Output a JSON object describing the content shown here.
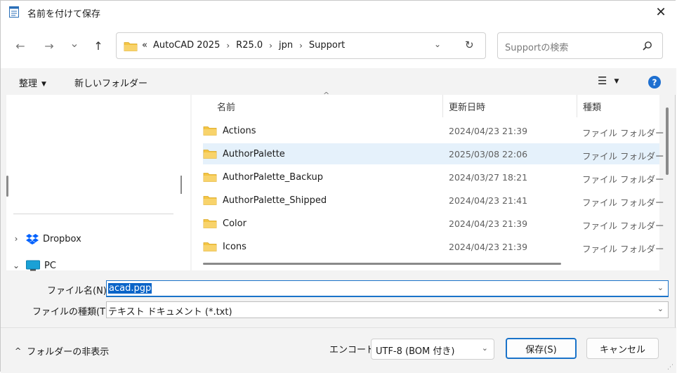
{
  "window": {
    "title": "名前を付けて保存",
    "close_glyph": "✕"
  },
  "nav": {
    "back_glyph": "←",
    "forward_glyph": "→",
    "recent_glyph": "⌄",
    "up_glyph": "↑",
    "address": {
      "prefix": "«",
      "crumbs": [
        "AutoCAD 2025",
        "R25.0",
        "jpn",
        "Support"
      ],
      "separator": "›",
      "dropdown_glyph": "⌄",
      "refresh_glyph": "↻"
    },
    "search_placeholder": "Supportの検索"
  },
  "toolbar": {
    "organize_label": "整理",
    "organize_caret": "▼",
    "new_folder_label": "新しいフォルダー",
    "view_glyph": "☰",
    "view_caret": "▼",
    "help_glyph": "?"
  },
  "sidebar": {
    "items": [
      {
        "label": "Dropbox",
        "chevron": "›",
        "icon": "dropbox-icon"
      },
      {
        "label": "PC",
        "chevron": "⌄",
        "icon": "pc-icon"
      }
    ]
  },
  "file_list": {
    "sort_indicator": "^",
    "columns": {
      "name": "名前",
      "date": "更新日時",
      "type": "種類"
    },
    "rows": [
      {
        "name": "Actions",
        "date": "2024/04/23 21:39",
        "type": "ファイル フォルダー",
        "selected": false
      },
      {
        "name": "AuthorPalette",
        "date": "2025/03/08 22:06",
        "type": "ファイル フォルダー",
        "selected": true
      },
      {
        "name": "AuthorPalette_Backup",
        "date": "2024/03/27 18:21",
        "type": "ファイル フォルダー",
        "selected": false
      },
      {
        "name": "AuthorPalette_Shipped",
        "date": "2024/04/23 21:41",
        "type": "ファイル フォルダー",
        "selected": false
      },
      {
        "name": "Color",
        "date": "2024/04/23 21:39",
        "type": "ファイル フォルダー",
        "selected": false
      },
      {
        "name": "Icons",
        "date": "2024/04/23 21:39",
        "type": "ファイル フォルダー",
        "selected": false
      }
    ]
  },
  "save_form": {
    "filename_label": "ファイル名(N):",
    "filename_value": "acad.pgp",
    "filetype_label": "ファイルの種類(T):",
    "filetype_value": "テキスト ドキュメント (*.txt)",
    "dropdown_glyph": "⌄"
  },
  "footer": {
    "hide_folders_label": "フォルダーの非表示",
    "hide_folders_chevron": "^",
    "encoding_label": "エンコード:",
    "encoding_value": "UTF-8 (BOM 付き)",
    "encoding_dropdown_glyph": "⌄",
    "save_label": "保存(S)",
    "cancel_label": "キャンセル",
    "grip_glyph": "⋰"
  },
  "colors": {
    "accent": "#1a73c9",
    "folder": "#f4c543",
    "selected_row": "#e5f1fb",
    "help": "#1e6fd0"
  }
}
